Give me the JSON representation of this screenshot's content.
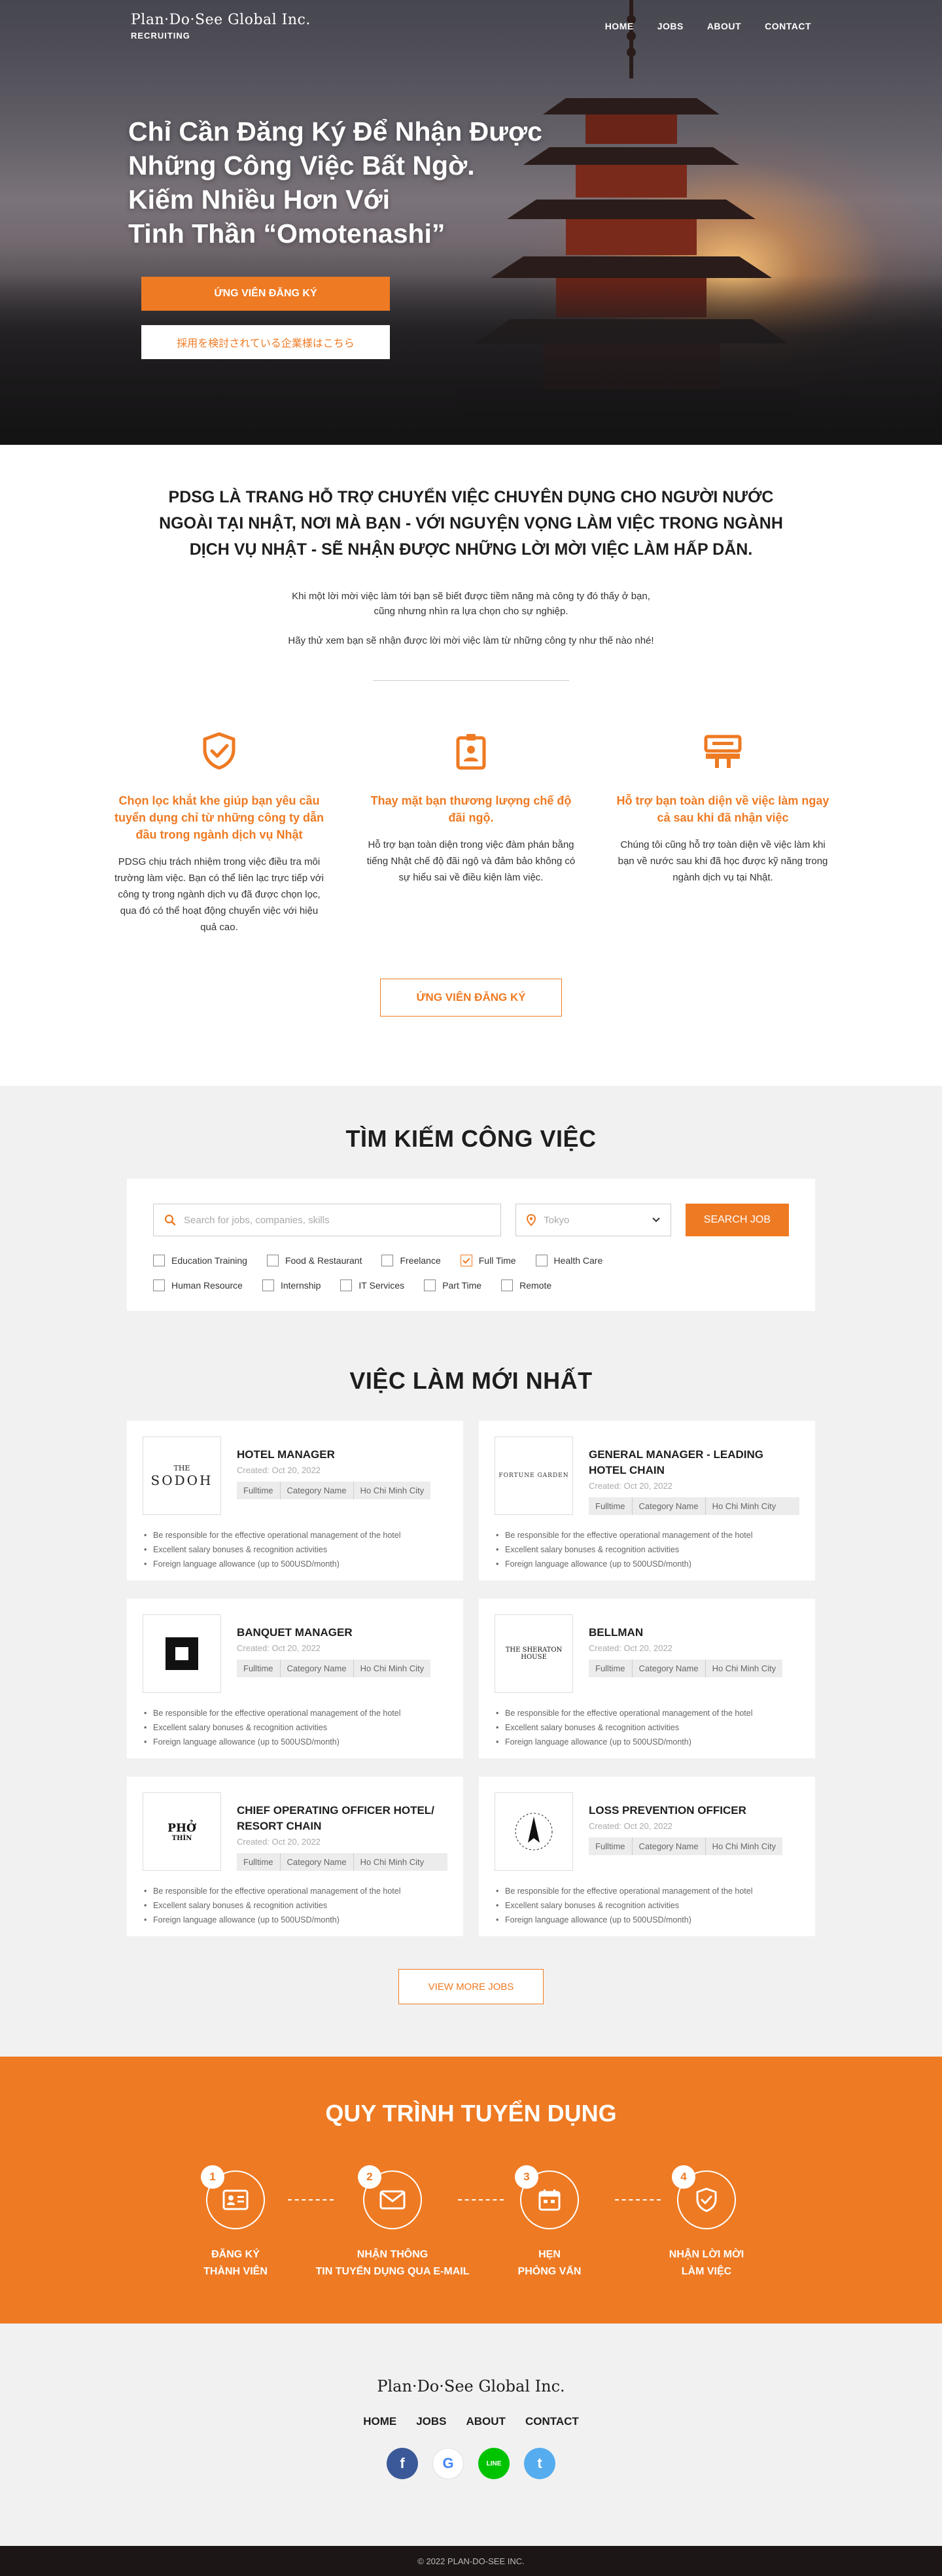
{
  "brand": {
    "name": "Plan·Do·See Global Inc.",
    "sub": "RECRUITING"
  },
  "nav": [
    "HOME",
    "JOBS",
    "ABOUT",
    "CONTACT"
  ],
  "hero": {
    "title_lines": [
      "Chỉ Cần Đăng Ký Để Nhận Được",
      "Những Công Việc Bất Ngờ.",
      "Kiếm Nhiều Hơn Với",
      "Tinh Thần “Omotenashi”"
    ],
    "primary_btn": "ỨNG VIÊN ĐĂNG KÝ",
    "secondary_btn": "採用を検討されている企業様はこちら"
  },
  "intro": {
    "heading": "PDSG LÀ TRANG HỖ TRỢ CHUYỂN VIỆC CHUYÊN DỤNG CHO NGƯỜI NƯỚC NGOÀI TẠI NHẬT, NƠI MÀ BẠN - VỚI NGUYỆN VỌNG LÀM VIỆC TRONG NGÀNH DỊCH VỤ NHẬT - SẼ NHẬN ĐƯỢC NHỮNG LỜI MỜI VIỆC LÀM HẤP DẪN.",
    "text1_line1": "Khi một lời mời việc làm tới bạn sẽ biết được tiềm năng mà công ty đó thấy ở bạn,",
    "text1_line2": "cũng nhưng nhìn ra lựa chọn cho sự nghiệp.",
    "text2": "Hãy thử xem bạn sẽ nhận được lời mời việc làm từ những công ty như thế nào nhé!"
  },
  "features": [
    {
      "icon": "shield-check-icon",
      "title": "Chọn lọc khắt khe giúp bạn yêu cầu tuyển dụng chỉ từ những công ty dẫn đầu trong ngành dịch vụ Nhật",
      "desc": "PDSG chịu trách nhiệm trong việc điều tra môi trường làm việc. Bạn có thể liên lạc trực tiếp với công ty trong ngành dịch vụ đã được chọn lọc, qua đó có thể hoạt động chuyển việc với hiệu quả cao."
    },
    {
      "icon": "id-badge-icon",
      "title": "Thay mặt bạn thương lượng chế độ đãi ngộ.",
      "desc": "Hỗ trợ bạn toàn diện trong việc đàm phán bằng tiếng Nhật chế độ đãi ngộ và đảm bảo không có sự hiểu sai về điều kiện làm việc."
    },
    {
      "icon": "support-desk-icon",
      "title": "Hỗ trợ bạn toàn diện về việc làm ngay cả sau khi đã nhận việc",
      "desc": "Chúng tôi cũng hỗ trợ toàn diện về việc làm khi bạn về nước sau khi đã học được kỹ năng trong ngành dịch vụ tại Nhật."
    }
  ],
  "apply_btn": "ỨNG VIÊN ĐĂNG KÝ",
  "search": {
    "title": "TÌM KIẾM CÔNG VIỆC",
    "placeholder": "Search for jobs, companies, skills",
    "location": "Tokyo",
    "button": "SEARCH JOB",
    "categories": [
      {
        "label": "Education Training",
        "checked": false
      },
      {
        "label": "Food & Restaurant",
        "checked": false
      },
      {
        "label": "Freelance",
        "checked": false
      },
      {
        "label": "Full Time",
        "checked": true
      },
      {
        "label": "Health Care",
        "checked": false
      },
      {
        "label": "Human Resource",
        "checked": false
      },
      {
        "label": "Internship",
        "checked": false
      },
      {
        "label": "IT Services",
        "checked": false
      },
      {
        "label": "Part Time",
        "checked": false
      },
      {
        "label": "Remote",
        "checked": false
      }
    ]
  },
  "jobs": {
    "title": "VIỆC LÀM MỚI NHẤT",
    "items": [
      {
        "title": "HOTEL MANAGER",
        "logo": "sodoh-logo",
        "logo_text": "SODOH",
        "logo_sub": "THE",
        "date": "Created: Oct 20, 2022",
        "tags": [
          "Fulltime",
          "Category Name",
          "Ho Chi Minh City"
        ],
        "bullets": [
          "Be responsible for the effective operational management of the hotel",
          "Excellent salary bonuses & recognition activities",
          "Foreign language allowance (up to 500USD/month)"
        ]
      },
      {
        "title": "GENERAL MANAGER - LEADING HOTEL CHAIN",
        "logo": "fortune-garden-logo",
        "logo_text": "FORTUNE GARDEN",
        "logo_sub": "",
        "date": "Created: Oct 20, 2022",
        "tags": [
          "Fulltime",
          "Category Name",
          "Ho Chi Minh City"
        ],
        "bullets": [
          "Be responsible for the effective operational management of the hotel",
          "Excellent salary bonuses & recognition activities",
          "Foreign language allowance (up to 500USD/month)"
        ]
      },
      {
        "title": "BANQUET MANAGER",
        "logo": "square-logo",
        "logo_text": "",
        "logo_sub": "",
        "date": "Created: Oct 20, 2022",
        "tags": [
          "Fulltime",
          "Category Name",
          "Ho Chi Minh City"
        ],
        "bullets": [
          "Be responsible for the effective operational management of the hotel",
          "Excellent salary bonuses & recognition activities",
          "Foreign language allowance (up to 500USD/month)"
        ]
      },
      {
        "title": "BELLMAN",
        "logo": "sheraton-house-logo",
        "logo_text": "THE SHERATON HOUSE",
        "logo_sub": "",
        "date": "Created: Oct 20, 2022",
        "tags": [
          "Fulltime",
          "Category Name",
          "Ho Chi Minh City"
        ],
        "bullets": [
          "Be responsible for the effective operational management of the hotel",
          "Excellent salary bonuses & recognition activities",
          "Foreign language allowance (up to 500USD/month)"
        ]
      },
      {
        "title": "CHIEF OPERATING OFFICER HOTEL/ RESORT CHAIN",
        "logo": "pho-thin-logo",
        "logo_text": "PHỞ",
        "logo_sub": "THÌN",
        "date": "Created: Oct 20, 2022",
        "tags": [
          "Fulltime",
          "Category Name",
          "Ho Chi Minh City"
        ],
        "bullets": [
          "Be responsible for the effective operational management of the hotel",
          "Excellent salary bonuses & recognition activities",
          "Foreign language allowance (up to 500USD/month)"
        ]
      },
      {
        "title": "LOSS PREVENTION OFFICER",
        "logo": "arrow-logo",
        "logo_text": "",
        "logo_sub": "",
        "date": "Created: Oct 20, 2022",
        "tags": [
          "Fulltime",
          "Category Name",
          "Ho Chi Minh City"
        ],
        "bullets": [
          "Be responsible for the effective operational management of the hotel",
          "Excellent salary bonuses & recognition activities",
          "Foreign language allowance (up to 500USD/month)"
        ]
      }
    ],
    "more_btn": "VIEW MORE JOBS"
  },
  "process": {
    "title": "QUY TRÌNH TUYỂN DỤNG",
    "steps": [
      {
        "num": "1",
        "icon": "id-card-icon",
        "line1": "ĐĂNG KÝ",
        "line2": "THÀNH VIÊN"
      },
      {
        "num": "2",
        "icon": "mail-icon",
        "line1": "NHẬN THÔNG",
        "line2": "TIN TUYỂN DỤNG QUA E-MAIL"
      },
      {
        "num": "3",
        "icon": "calendar-icon",
        "line1": "HẸN",
        "line2": "PHỎNG VẤN"
      },
      {
        "num": "4",
        "icon": "shield-check-icon",
        "line1": "NHẬN LỜI MỜI",
        "line2": "LÀM VIỆC"
      }
    ]
  },
  "footer": {
    "brand": "Plan·Do·See Global Inc.",
    "links": [
      "HOME",
      "JOBS",
      "ABOUT",
      "CONTACT"
    ],
    "socials": [
      {
        "name": "facebook-icon",
        "glyph": "f",
        "color": "#3b5998"
      },
      {
        "name": "google-icon",
        "glyph": "G",
        "color": "#ffffff"
      },
      {
        "name": "line-icon",
        "glyph": "LINE",
        "color": "#00c300"
      },
      {
        "name": "twitter-icon",
        "glyph": "t",
        "color": "#55acee"
      }
    ],
    "copyright": "© 2022 PLAN-DO-SEE INC."
  },
  "colors": {
    "accent": "#ee7a23",
    "dark": "#1d1616",
    "gray_bg": "#f1f1f1"
  }
}
